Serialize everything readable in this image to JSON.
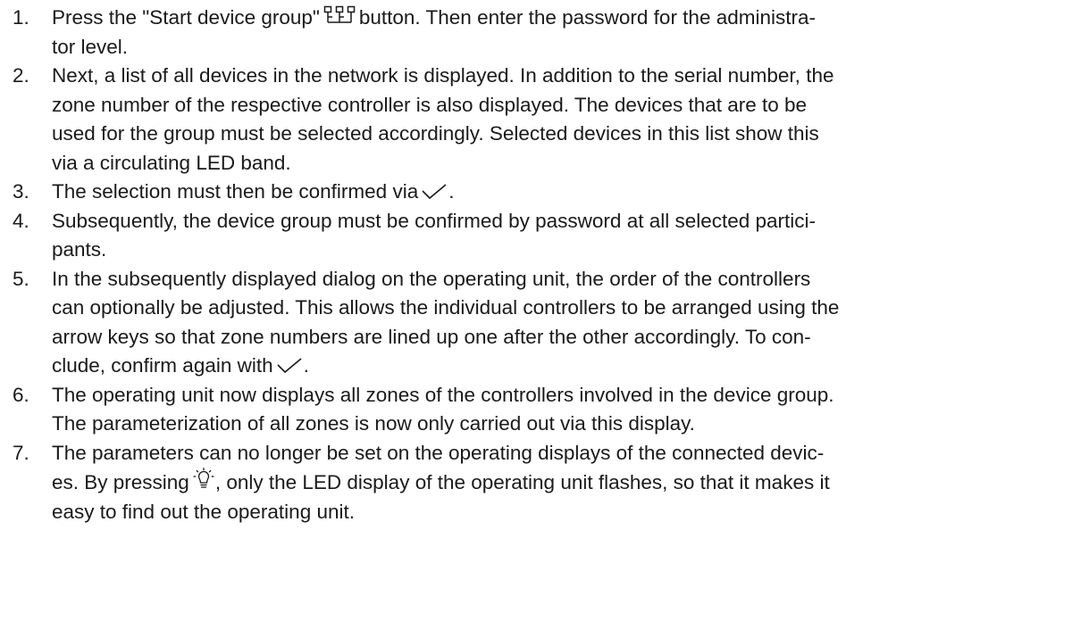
{
  "steps": [
    {
      "number": "1.",
      "lines": [
        {
          "pre": "Press the \"Start device group\"",
          "icon": "device-group-icon",
          "post": "button. Then enter the password for the administra-"
        },
        {
          "text": "tor level."
        }
      ]
    },
    {
      "number": "2.",
      "lines": [
        {
          "text": "Next, a list of all devices in the network is displayed. In addition to the serial number, the"
        },
        {
          "text": "zone number of the respective controller is also displayed. The devices that are to be"
        },
        {
          "text": "used for the group must be selected accordingly. Selected devices in this list show this"
        },
        {
          "text": "via a circulating LED band."
        }
      ]
    },
    {
      "number": "3.",
      "lines": [
        {
          "pre": "The selection must then be confirmed via",
          "icon": "checkmark-icon",
          "post": "."
        }
      ]
    },
    {
      "number": "4.",
      "lines": [
        {
          "text": "Subsequently, the device group must be confirmed by password at all selected partici-"
        },
        {
          "text": "pants."
        }
      ]
    },
    {
      "number": "5.",
      "lines": [
        {
          "text": "In the subsequently displayed dialog on the operating unit, the order of the controllers"
        },
        {
          "text": "can optionally be adjusted. This allows the individual controllers to be arranged using the"
        },
        {
          "text": "arrow keys so that zone numbers are lined up one after the other accordingly. To con-"
        },
        {
          "pre": "clude, confirm again with",
          "icon": "checkmark-icon",
          "post": "."
        }
      ]
    },
    {
      "number": "6.",
      "lines": [
        {
          "text": "The operating unit now displays all zones of the controllers involved in the device group."
        },
        {
          "text": "The parameterization of all zones is now only carried out via this display."
        }
      ]
    },
    {
      "number": "7.",
      "lines": [
        {
          "text": "The parameters can no longer be set on the operating displays of the connected devic-"
        },
        {
          "pre": "es. By pressing",
          "icon": "lightbulb-icon",
          "post": ", only the LED display of the operating unit flashes, so that it makes it"
        },
        {
          "text": "easy to find out the operating unit."
        }
      ]
    }
  ]
}
